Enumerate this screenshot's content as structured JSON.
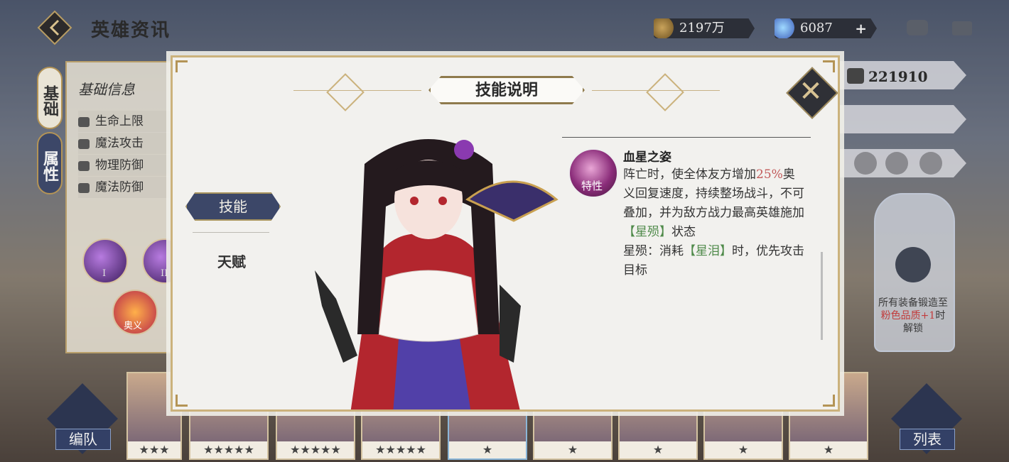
{
  "header": {
    "title": "英雄资讯"
  },
  "currency": {
    "gold": "2197万",
    "gems": "6087",
    "plus": "+"
  },
  "left_panel": {
    "tab_basic": "基础",
    "tab_attr": "属性",
    "section_title": "基础信息",
    "stats": [
      "生命上限",
      "魔法攻击",
      "物理防御",
      "魔法防御"
    ],
    "orb_labels": [
      "I",
      "II",
      "奥义"
    ]
  },
  "right_panel": {
    "power": "221910",
    "lock_text_a": "所有装备锻造至",
    "lock_text_hl": "粉色品质+1",
    "lock_text_b": "时解锁"
  },
  "bottom": {
    "team_button": "编队",
    "list_button": "列表",
    "hero_stars": [
      "★★★",
      "★★★★★",
      "★★★★★",
      "★★★★★",
      "★",
      "★",
      "★",
      "★",
      "★"
    ]
  },
  "modal": {
    "title": "技能说明",
    "close": "✕",
    "tabs": {
      "skill": "技能",
      "talent": "天赋"
    },
    "skill": {
      "icon_label": "特性",
      "name": "血星之姿",
      "desc_1": "阵亡时，使全体友方增加",
      "desc_pct": "25%",
      "desc_2": "奥义回复速度，持续整场战斗，不可叠加，并为敌方战力最高英雄施加",
      "desc_kw1": "【星殒】",
      "desc_3": "状态",
      "desc_4": "星殒：消耗",
      "desc_kw2": "【星泪】",
      "desc_5": "时，优先攻击目标"
    }
  },
  "colors": {
    "accent_gold": "#cbb27c",
    "tab_navy": "#3c4768",
    "highlight_red": "#c25a5a",
    "highlight_green": "#4f8a4a"
  }
}
